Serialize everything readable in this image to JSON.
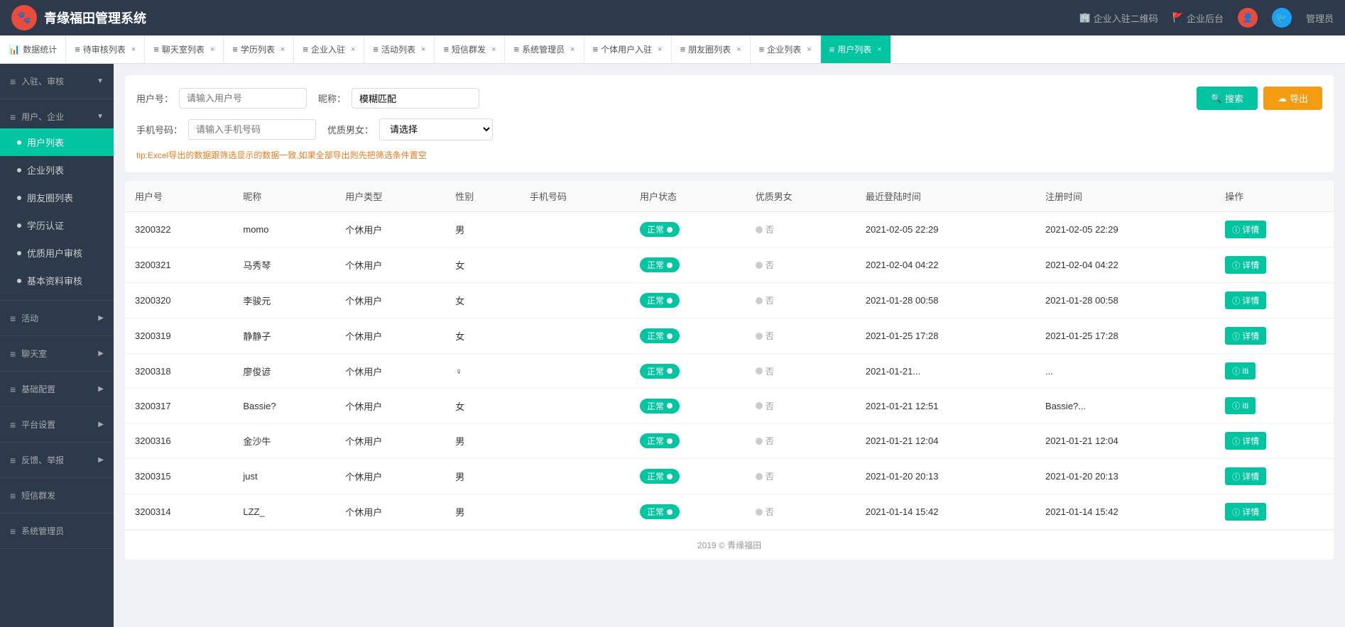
{
  "header": {
    "title": "青缘福田管理系统",
    "actions": {
      "enterprise_qr": "企业入驻二维码",
      "enterprise_backend": "企业后台",
      "manager": "管理员"
    }
  },
  "tabs": [
    {
      "id": "data-stats",
      "label": "数据统计",
      "closable": false,
      "active": false
    },
    {
      "id": "pending-review",
      "label": "待审核列表",
      "closable": true,
      "active": false
    },
    {
      "id": "chat-room",
      "label": "聊天室列表",
      "closable": true,
      "active": false
    },
    {
      "id": "education",
      "label": "学历列表",
      "closable": true,
      "active": false
    },
    {
      "id": "enterprise-entry",
      "label": "企业入驻",
      "closable": true,
      "active": false
    },
    {
      "id": "activity-list",
      "label": "活动列表",
      "closable": true,
      "active": false
    },
    {
      "id": "sms-group",
      "label": "短信群发",
      "closable": true,
      "active": false
    },
    {
      "id": "sys-manager",
      "label": "系统管理员",
      "closable": true,
      "active": false
    },
    {
      "id": "personal-entry",
      "label": "个体用户入驻",
      "closable": true,
      "active": false
    },
    {
      "id": "moments-list",
      "label": "朋友圈列表",
      "closable": true,
      "active": false
    },
    {
      "id": "enterprise-list",
      "label": "企业列表",
      "closable": true,
      "active": false
    },
    {
      "id": "user-list",
      "label": "用户列表",
      "closable": true,
      "active": true
    }
  ],
  "sidebar": {
    "sections": [
      {
        "id": "admission-review",
        "label": "入驻、审核",
        "icon": "≡",
        "expanded": true,
        "items": []
      },
      {
        "id": "user-enterprise",
        "label": "用户、企业",
        "icon": "≡",
        "expanded": true,
        "items": [
          {
            "id": "user-list",
            "label": "用户列表",
            "active": true
          },
          {
            "id": "enterprise-list",
            "label": "企业列表",
            "active": false
          },
          {
            "id": "moments-list",
            "label": "朋友圈列表",
            "active": false
          },
          {
            "id": "education-cert",
            "label": "学历认证",
            "active": false
          },
          {
            "id": "quality-review",
            "label": "优质用户审核",
            "active": false
          },
          {
            "id": "basic-data-review",
            "label": "基本资料审核",
            "active": false
          }
        ]
      },
      {
        "id": "activity",
        "label": "活动",
        "icon": "≡",
        "expanded": false,
        "items": []
      },
      {
        "id": "chat-room-section",
        "label": "聊天室",
        "icon": "≡",
        "expanded": false,
        "items": []
      },
      {
        "id": "basic-config",
        "label": "基础配置",
        "icon": "≡",
        "expanded": false,
        "items": []
      },
      {
        "id": "platform-settings",
        "label": "平台设置",
        "icon": "≡",
        "expanded": false,
        "items": []
      },
      {
        "id": "feedback-report",
        "label": "反馈、举报",
        "icon": "≡",
        "expanded": false,
        "items": []
      },
      {
        "id": "sms-group-send",
        "label": "短信群发",
        "icon": "≡",
        "expanded": false,
        "items": []
      },
      {
        "id": "sys-admin",
        "label": "系统管理员",
        "icon": "≡",
        "expanded": false,
        "items": []
      }
    ]
  },
  "search": {
    "user_no_label": "用户号：",
    "user_no_placeholder": "请输入用户号",
    "nickname_label": "昵称：",
    "nickname_value": "模糊匹配",
    "phone_label": "手机号码：",
    "phone_placeholder": "请输入手机号码",
    "quality_label": "优质男女：",
    "quality_placeholder": "请选择",
    "search_btn": "搜索",
    "export_btn": "导出",
    "tip": "tip:Excel导出的数据跟筛选显示的数据一致,如果全部导出则先把筛选条件置空"
  },
  "table": {
    "columns": [
      "用户号",
      "昵称",
      "用户类型",
      "性别",
      "手机号码",
      "用户状态",
      "优质男女",
      "最近登陆时间",
      "注册时间",
      "操作"
    ],
    "rows": [
      {
        "id": "3200322",
        "nickname": "momo",
        "type": "个休用户",
        "gender": "男",
        "phone": "",
        "status": "正常",
        "quality": "否",
        "last_login": "2021-02-05 22:29",
        "reg_time": "2021-02-05 22:29",
        "action": "详情"
      },
      {
        "id": "3200321",
        "nickname": "马秀琴",
        "type": "个休用户",
        "gender": "女",
        "phone": "",
        "status": "正常",
        "quality": "否",
        "last_login": "2021-02-04 04:22",
        "reg_time": "2021-02-04 04:22",
        "action": "详情"
      },
      {
        "id": "3200320",
        "nickname": "李骏元",
        "type": "个休用户",
        "gender": "女",
        "phone": "",
        "status": "正常",
        "quality": "否",
        "last_login": "2021-01-28 00:58",
        "reg_time": "2021-01-28 00:58",
        "action": "详情"
      },
      {
        "id": "3200319",
        "nickname": "静静子",
        "type": "个休用户",
        "gender": "女",
        "phone": "",
        "status": "正常",
        "quality": "否",
        "last_login": "2021-01-25 17:28",
        "reg_time": "2021-01-25 17:28",
        "action": "详情"
      },
      {
        "id": "3200318",
        "nickname": "廖俊谚",
        "type": "个休用户",
        "gender": "♀",
        "phone": "",
        "status": "正常",
        "quality": "否",
        "last_login": "2021-01-21...",
        "reg_time": "...",
        "action": "iti"
      },
      {
        "id": "3200317",
        "nickname": "Bassie?",
        "type": "个休用户",
        "gender": "女",
        "phone": "",
        "status": "正常",
        "quality": "否",
        "last_login": "2021-01-21 12:51",
        "reg_time": "Bassie?...",
        "action": "iti"
      },
      {
        "id": "3200316",
        "nickname": "金沙牛",
        "type": "个休用户",
        "gender": "男",
        "phone": "",
        "status": "正常",
        "quality": "否",
        "last_login": "2021-01-21 12:04",
        "reg_time": "2021-01-21 12:04",
        "action": "详情"
      },
      {
        "id": "3200315",
        "nickname": "just",
        "type": "个休用户",
        "gender": "男",
        "phone": "",
        "status": "正常",
        "quality": "否",
        "last_login": "2021-01-20 20:13",
        "reg_time": "2021-01-20 20:13",
        "action": "详情"
      },
      {
        "id": "3200314",
        "nickname": "LZZ_",
        "type": "个休用户",
        "gender": "男",
        "phone": "",
        "status": "正常",
        "quality": "否",
        "last_login": "2021-01-14 15:42",
        "reg_time": "2021-01-14 15:42",
        "action": "详情"
      }
    ]
  },
  "footer": {
    "text": "2019 © 青缘福田"
  },
  "colors": {
    "primary": "#00c5a0",
    "sidebar_bg": "#2d3a4b",
    "warning": "#f39c12",
    "text_tip": "#e67e22"
  }
}
